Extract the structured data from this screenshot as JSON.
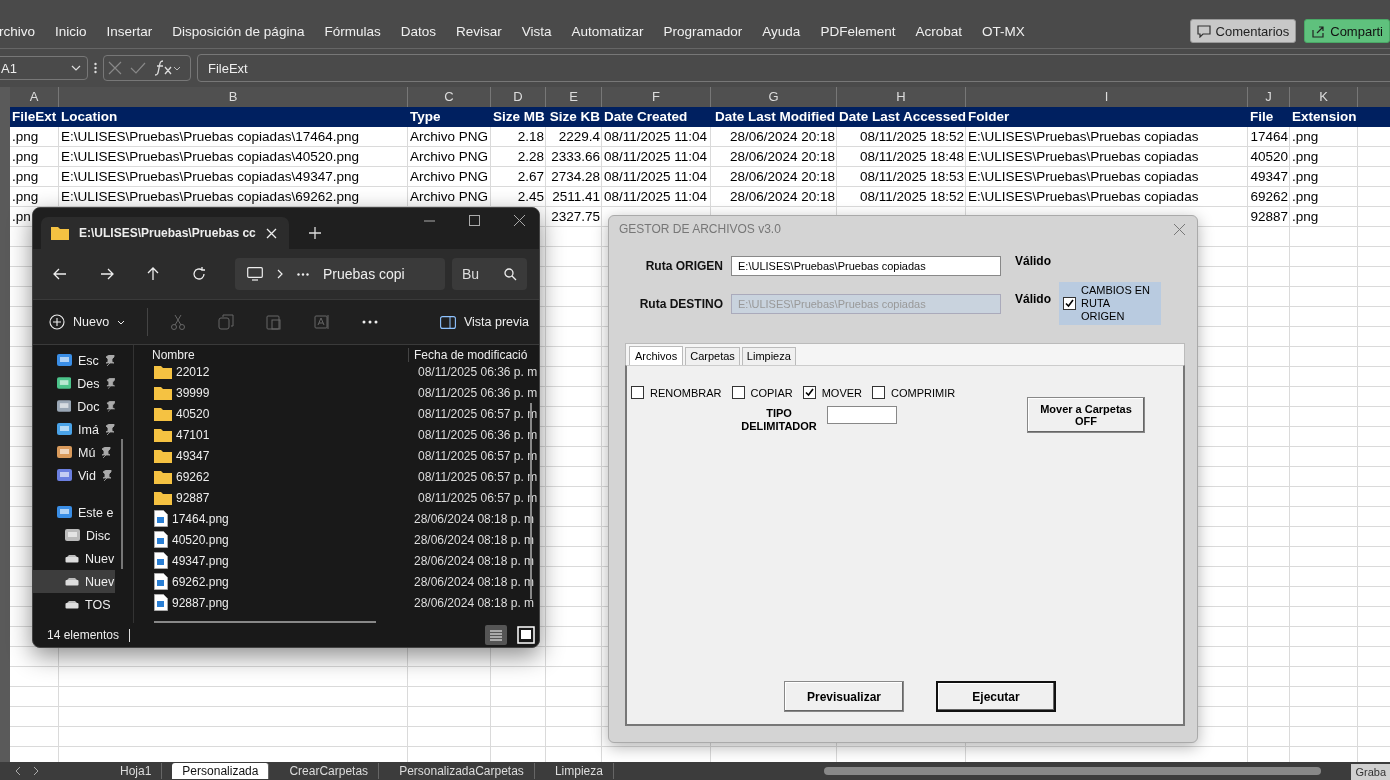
{
  "ribbon": {
    "menu": [
      {
        "label": "rchivo"
      },
      {
        "label": "Inicio"
      },
      {
        "label": "Insertar"
      },
      {
        "label": "Disposición de página"
      },
      {
        "label": "Fórmulas"
      },
      {
        "label": "Datos"
      },
      {
        "label": "Revisar"
      },
      {
        "label": "Vista"
      },
      {
        "label": "Automatizar"
      },
      {
        "label": "Programador"
      },
      {
        "label": "Ayuda"
      },
      {
        "label": "PDFelement"
      },
      {
        "label": "Acrobat"
      },
      {
        "label": "OT-MX"
      }
    ],
    "comments_button": "Comentarios",
    "share_button": "Comparti"
  },
  "formula_bar": {
    "name_box": "A1",
    "formula": "FileExt"
  },
  "sheet": {
    "column_letters": [
      "A",
      "B",
      "C",
      "D",
      "E",
      "F",
      "G",
      "H",
      "I",
      "J",
      "K"
    ],
    "header": [
      "FileExt",
      "Location",
      "Type",
      "Size MB",
      "Size KB",
      "Date Created",
      "Date Last Modified",
      "Date Last Accessed",
      "Folder",
      "File",
      "Extension"
    ],
    "rows": [
      [
        ".png",
        "E:\\ULISES\\Pruebas\\Pruebas copiadas\\17464.png",
        "Archivo PNG",
        "2.18",
        "2229.4",
        "08/11/2025 11:04",
        "28/06/2024 20:18",
        "08/11/2025 18:52",
        "E:\\ULISES\\Pruebas\\Pruebas copiadas",
        "17464",
        ".png"
      ],
      [
        ".png",
        "E:\\ULISES\\Pruebas\\Pruebas copiadas\\40520.png",
        "Archivo PNG",
        "2.28",
        "2333.66",
        "08/11/2025 11:04",
        "28/06/2024 20:18",
        "08/11/2025 18:48",
        "E:\\ULISES\\Pruebas\\Pruebas copiadas",
        "40520",
        ".png"
      ],
      [
        ".png",
        "E:\\ULISES\\Pruebas\\Pruebas copiadas\\49347.png",
        "Archivo PNG",
        "2.67",
        "2734.28",
        "08/11/2025 11:04",
        "28/06/2024 20:18",
        "08/11/2025 18:53",
        "E:\\ULISES\\Pruebas\\Pruebas copiadas",
        "49347",
        ".png"
      ],
      [
        ".png",
        "E:\\ULISES\\Pruebas\\Pruebas copiadas\\69262.png",
        "Archivo PNG",
        "2.45",
        "2511.41",
        "08/11/2025 11:04",
        "28/06/2024 20:18",
        "08/11/2025 18:52",
        "E:\\ULISES\\Pruebas\\Pruebas copiadas",
        "69262",
        ".png"
      ],
      [
        ".pn",
        null,
        null,
        null,
        "2327.75",
        null,
        null,
        null,
        null,
        "92887",
        ".png"
      ]
    ],
    "tabs": [
      {
        "label": "Hoja1",
        "selected": false
      },
      {
        "label": "Personalizada",
        "selected": true
      },
      {
        "label": "CrearCarpetas",
        "selected": false
      },
      {
        "label": "PersonalizadaCarpetas",
        "selected": false
      },
      {
        "label": "Limpieza",
        "selected": false
      }
    ],
    "record_button": "Graba"
  },
  "explorer": {
    "tab_title": "E:\\ULISES\\Pruebas\\Pruebas cc",
    "address": "Pruebas copi",
    "search": {
      "placeholder": "Bu"
    },
    "new_button": "Nuevo",
    "preview_button": "Vista previa",
    "sidebar": [
      {
        "label": "Esc",
        "pinned": true,
        "selected": false
      },
      {
        "label": "Des",
        "pinned": true,
        "selected": false
      },
      {
        "label": "Doc",
        "pinned": true,
        "selected": false
      },
      {
        "label": "Imá",
        "pinned": true,
        "selected": false
      },
      {
        "label": "Mú",
        "pinned": true,
        "selected": false
      },
      {
        "label": "Vid",
        "pinned": true,
        "selected": false
      },
      {
        "label": "Este e",
        "pinned": false,
        "selected": false
      },
      {
        "label": "Disc",
        "pinned": false,
        "selected": false
      },
      {
        "label": "Nuev",
        "pinned": false,
        "selected": false
      },
      {
        "label": "Nuev",
        "pinned": false,
        "selected": true
      },
      {
        "label": "TOS",
        "pinned": false,
        "selected": false
      }
    ],
    "columns": [
      "Nombre",
      "Fecha de modificació"
    ],
    "files": [
      {
        "kind": "folder",
        "name": "22012",
        "date": "08/11/2025 06:36 p. m"
      },
      {
        "kind": "folder",
        "name": "39999",
        "date": "08/11/2025 06:36 p. m"
      },
      {
        "kind": "folder",
        "name": "40520",
        "date": "08/11/2025 06:57 p. m"
      },
      {
        "kind": "folder",
        "name": "47101",
        "date": "08/11/2025 06:36 p. m"
      },
      {
        "kind": "folder",
        "name": "49347",
        "date": "08/11/2025 06:57 p. m"
      },
      {
        "kind": "folder",
        "name": "69262",
        "date": "08/11/2025 06:57 p. m"
      },
      {
        "kind": "folder",
        "name": "92887",
        "date": "08/11/2025 06:57 p. m"
      },
      {
        "kind": "file",
        "name": "17464.png",
        "date": "28/06/2024 08:18 p. m"
      },
      {
        "kind": "file",
        "name": "40520.png",
        "date": "28/06/2024 08:18 p. m"
      },
      {
        "kind": "file",
        "name": "49347.png",
        "date": "28/06/2024 08:18 p. m"
      },
      {
        "kind": "file",
        "name": "69262.png",
        "date": "28/06/2024 08:18 p. m"
      },
      {
        "kind": "file",
        "name": "92887.png",
        "date": "28/06/2024 08:18 p. m"
      }
    ],
    "status": "14 elementos"
  },
  "dialog": {
    "title": "GESTOR DE ARCHIVOS v3.0",
    "origin": {
      "label": "Ruta ORIGEN",
      "value": "E:\\ULISES\\Pruebas\\Pruebas copiadas",
      "disabled": false,
      "status": "Válido"
    },
    "destination": {
      "label": "Ruta DESTINO",
      "value": "E:\\ULISES\\Pruebas\\Pruebas copiadas",
      "disabled": true,
      "status": "Válido"
    },
    "same_path": {
      "label": "CAMBIOS EN RUTA ORIGEN",
      "checked": true
    },
    "tabs": [
      {
        "label": "Archivos",
        "selected": true
      },
      {
        "label": "Carpetas",
        "selected": false
      },
      {
        "label": "Limpieza",
        "selected": false
      }
    ],
    "options": [
      {
        "label": "RENOMBRAR",
        "checked": false
      },
      {
        "label": "COPIAR",
        "checked": false
      },
      {
        "label": "MOVER",
        "checked": true
      },
      {
        "label": "COMPRIMIR",
        "checked": false
      }
    ],
    "delimiter": {
      "label": "TIPO DELIMITADOR"
    },
    "move_button": "Mover a Carpetas OFF",
    "buttons": [
      {
        "label": "Previsualizar",
        "default": false
      },
      {
        "label": "Ejecutar",
        "default": true
      }
    ]
  }
}
